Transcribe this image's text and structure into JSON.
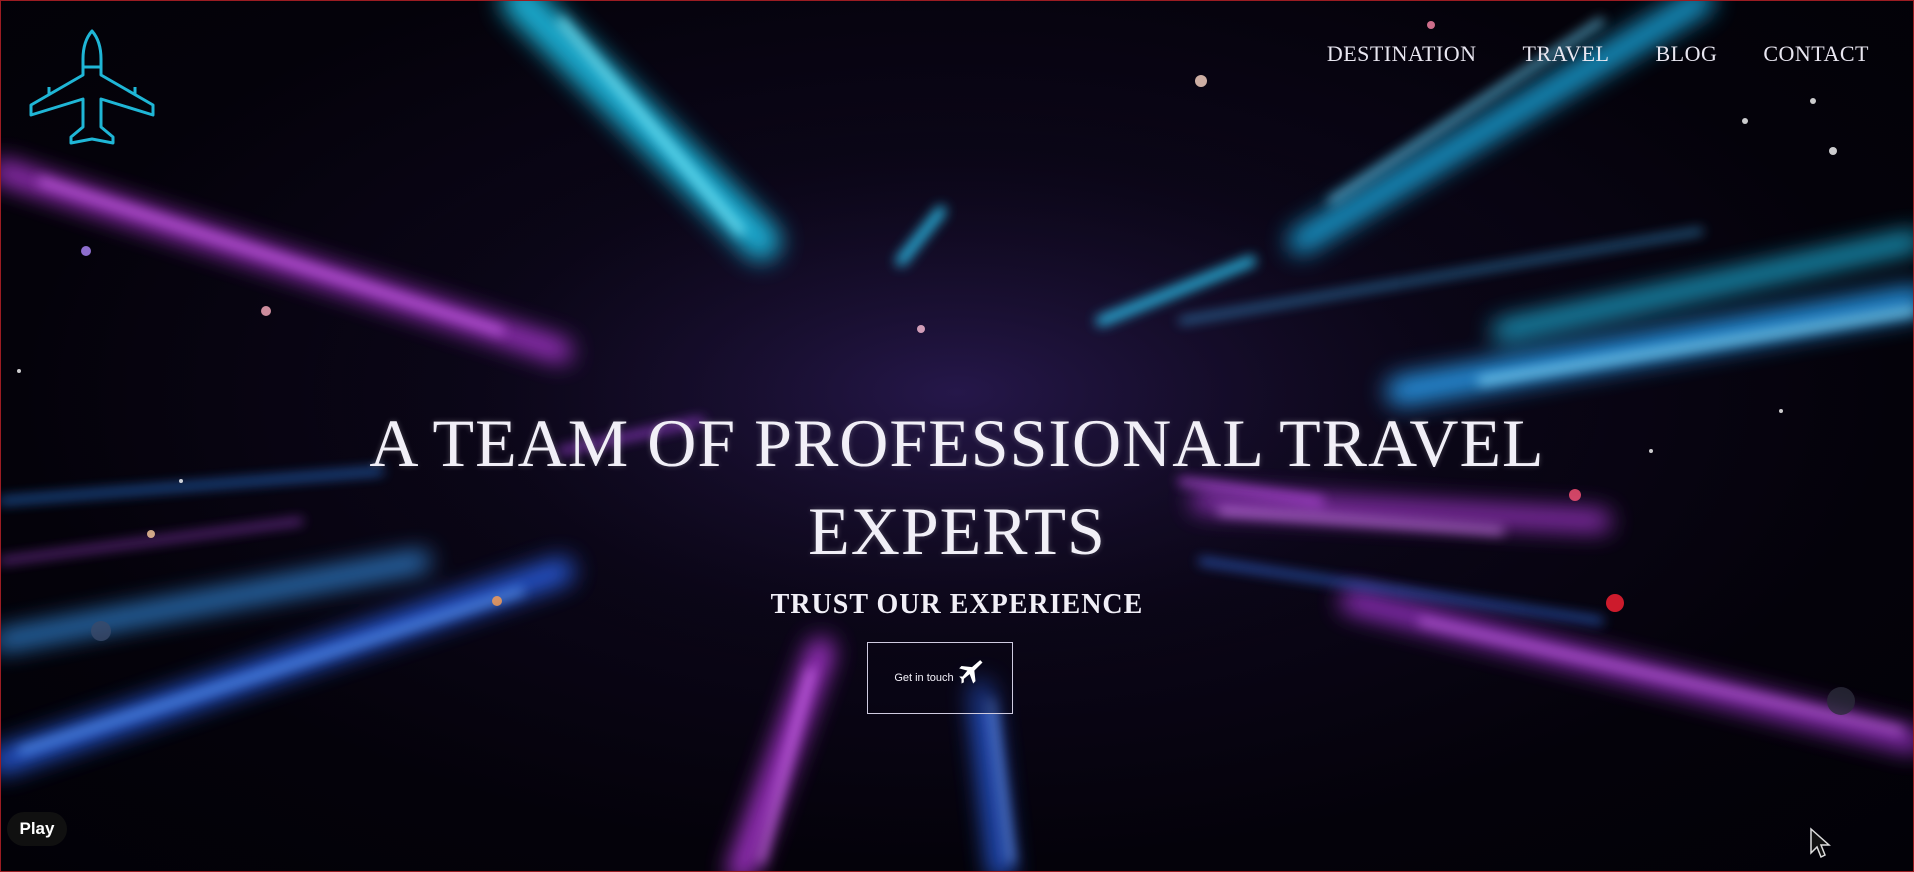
{
  "logo": {
    "icon": "airplane-icon",
    "color": "#1fb6d6"
  },
  "nav": {
    "items": [
      "DESTINATION",
      "TRAVEL",
      "BLOG",
      "CONTACT"
    ]
  },
  "hero": {
    "title": "A TEAM OF PROFESSIONAL TRAVEL EXPERTS",
    "subtitle": "TRUST OUR EXPERIENCE",
    "cta_label": "Get in touch",
    "cta_icon": "plane-icon"
  },
  "video": {
    "play_label": "Play"
  },
  "colors": {
    "text": "#f1eff7",
    "accent_cyan": "#1fb6d6",
    "accent_magenta": "#c43cf0",
    "accent_blue": "#2d6bff",
    "frame_border": "#9b1c22"
  }
}
